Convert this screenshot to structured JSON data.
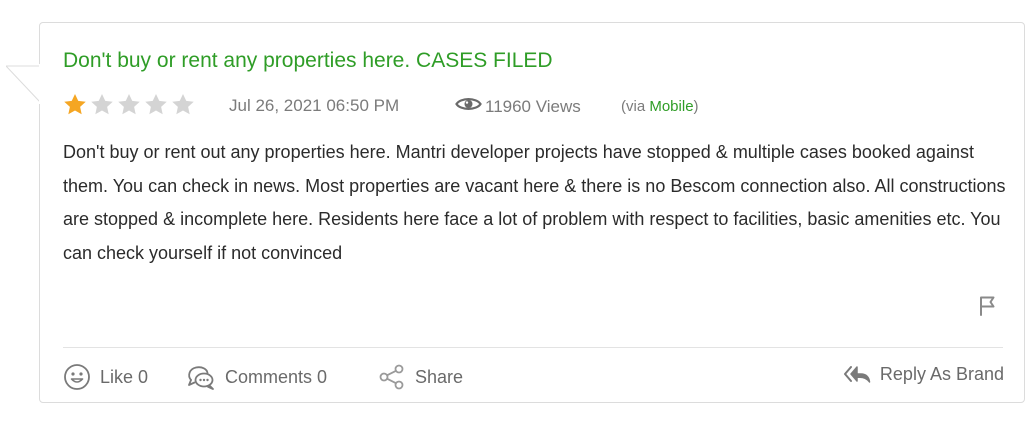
{
  "review": {
    "title": "Don't buy or rent any properties here. CASES FILED",
    "rating": 1,
    "rating_max": 5,
    "date": "Jul 26, 2021 06:50 PM",
    "views": "11960 Views",
    "via_prefix": "(via ",
    "via_source": "Mobile",
    "via_suffix": ")",
    "body": "Don't buy or rent out any properties here. Mantri developer projects have stopped & multiple cases booked against them. You can check in news. Most properties are vacant here & there is no Bescom connection also. All constructions are stopped & incomplete here. Residents here face a lot of problem with respect to facilities, basic amenities etc. You can check yourself if not convinced"
  },
  "actions": {
    "like_label": "Like 0",
    "comments_label": "Comments 0",
    "share_label": "Share",
    "reply_label": "Reply As Brand"
  },
  "icons": {
    "views": "eye-icon",
    "report": "flag-icon",
    "like": "smiley-icon",
    "comments": "chat-bubbles-icon",
    "share": "share-icon",
    "reply": "reply-all-icon"
  },
  "colors": {
    "accent_green": "#2f9d27",
    "star_filled": "#f5a623",
    "star_empty": "#d4d4d4",
    "muted_text": "#7b7b7b"
  }
}
